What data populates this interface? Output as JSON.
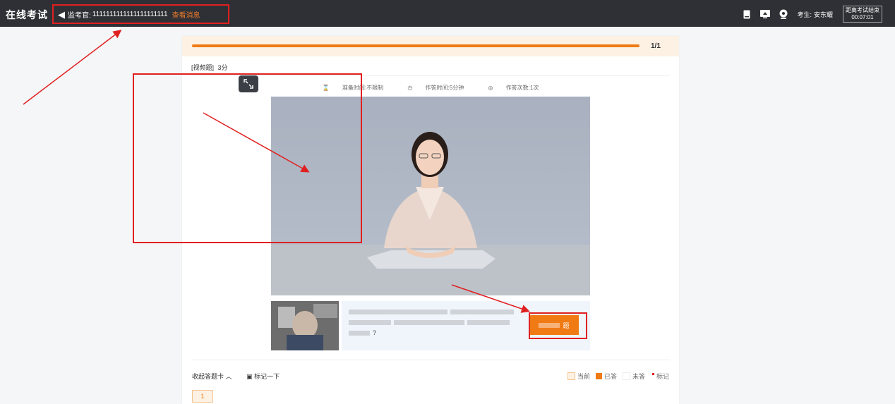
{
  "header": {
    "title": "在线考试",
    "proctor_label": "监考官:",
    "proctor_value": "1111111111111111111111",
    "view_message": "查看消息",
    "examinee_label": "考生:",
    "examinee_name": "安东耀",
    "timer_label": "距离考试结束",
    "timer_value": "00:07:01"
  },
  "progress": {
    "count": "1/1",
    "fraction": 1.0
  },
  "question": {
    "type_label": "[视频题]",
    "score": "3分",
    "prep_time": "准备时间:不限制",
    "answer_time": "作答时间:5分钟",
    "attempts": "作答次数:1次",
    "text_end": "?",
    "answer_button": "题"
  },
  "footer": {
    "collapse": "收起答题卡",
    "mark": "标记一下",
    "legend": [
      {
        "label": "当前",
        "color": "#fdf1e4"
      },
      {
        "label": "已答",
        "color": "#f07b14"
      },
      {
        "label": "未答",
        "color": "#ffffff"
      },
      {
        "label": "标记",
        "color": "#e02020"
      }
    ],
    "question_number": "1"
  },
  "colors": {
    "accent": "#f07b14",
    "annotation": "#e02020"
  },
  "icons": [
    "speaker-icon",
    "document-icon",
    "screen-icon",
    "webcam-icon",
    "fullscreen-exit-icon",
    "hourglass-icon",
    "clock-icon",
    "attempts-icon",
    "bookmark-icon",
    "chevron-up-icon"
  ]
}
